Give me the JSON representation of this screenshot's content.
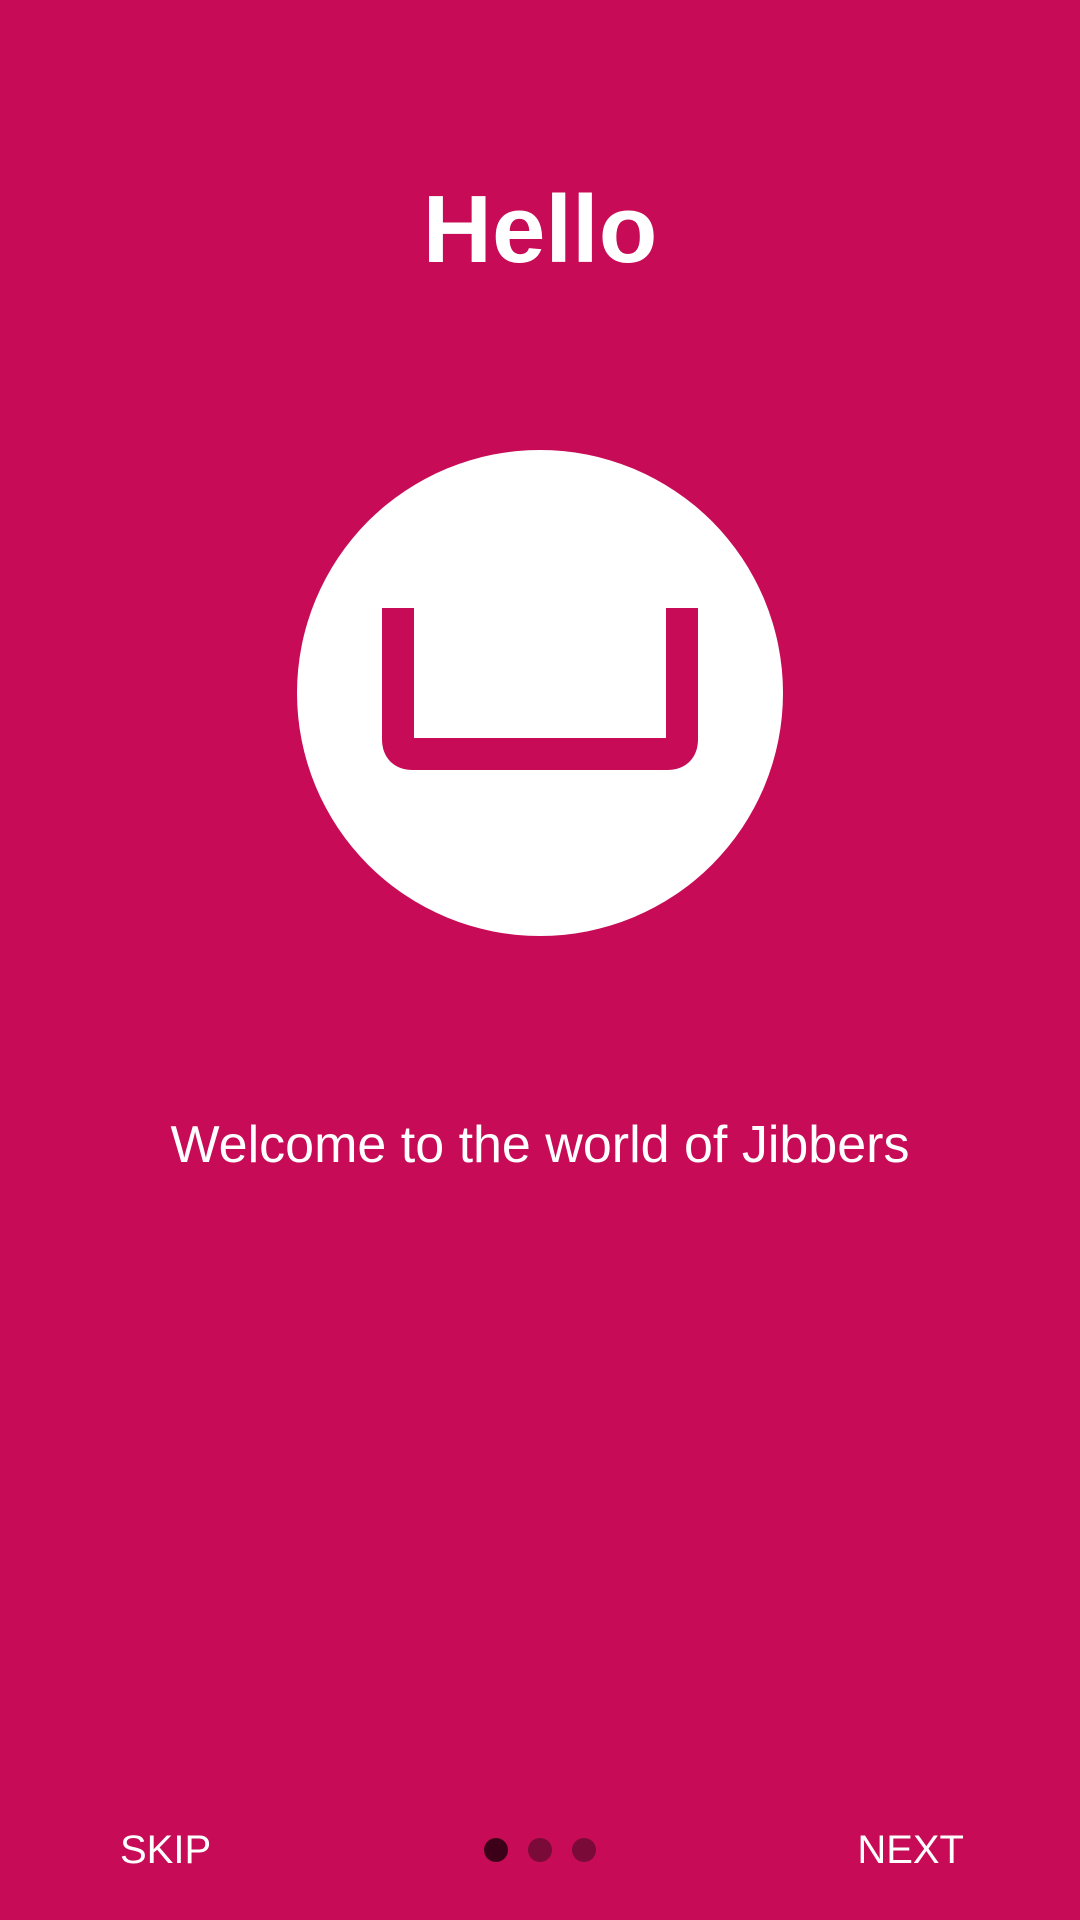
{
  "colors": {
    "background": "#c80b56",
    "foreground": "#ffffff",
    "dot_active": "#3d0019",
    "dot_inactive": "#7a0a38"
  },
  "onboarding": {
    "title": "Hello",
    "hero_icon": "space-bar-icon",
    "subtitle": "Welcome to the world of Jibbers"
  },
  "footer": {
    "skip_label": "SKIP",
    "next_label": "NEXT",
    "page_indicator": {
      "total": 3,
      "current": 1
    }
  }
}
